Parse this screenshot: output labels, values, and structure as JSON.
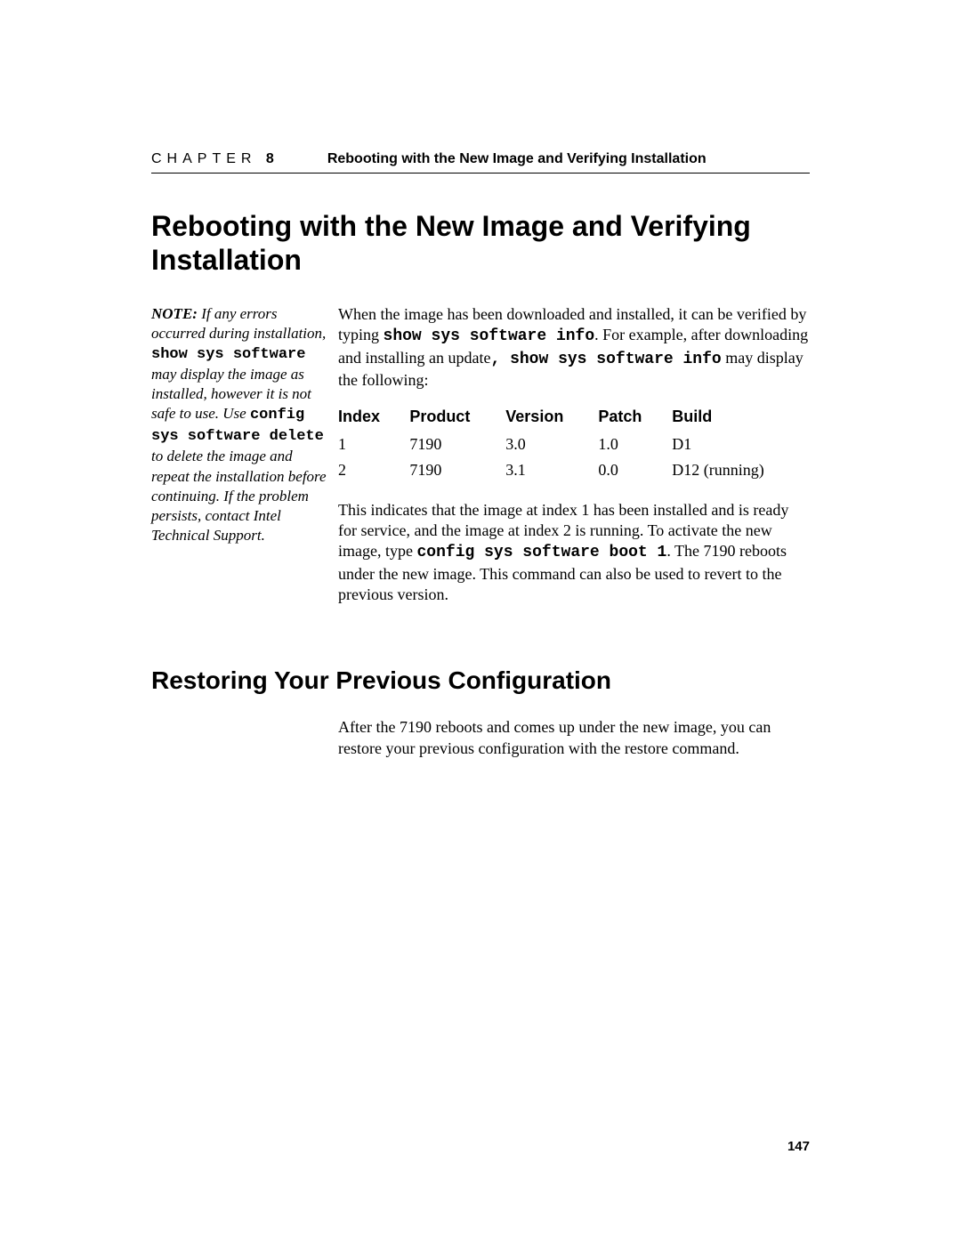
{
  "header": {
    "chapter_word": "CHAPTER",
    "chapter_num": "8",
    "title": "Rebooting with the New Image and Verifying Installation"
  },
  "section1": {
    "title": "Rebooting with the New Image and Verifying Installation",
    "note": {
      "lead": "NOTE:",
      "t1": "  If any errors occurred during installation, ",
      "c1": "show sys software",
      "t2": " may display the image as installed, however it is not safe to use. Use ",
      "c2": "config sys software delete",
      "t3": " to delete the image and repeat the installation before continuing. If the problem persists, contact Intel Technical Support."
    },
    "para1": {
      "t1": "When the image has been downloaded and installed, it can be verified by typing ",
      "c1": "show sys software info",
      "t2": ". For example, after downloading and installing an update",
      "c2": ", show sys software info",
      "t3": " may display the following:"
    },
    "table": {
      "headers": [
        "Index",
        "Product",
        "Version",
        "Patch",
        "Build"
      ],
      "rows": [
        [
          "1",
          "7190",
          "3.0",
          "1.0",
          "D1"
        ],
        [
          "2",
          "7190",
          "3.1",
          "0.0",
          "D12 (running)"
        ]
      ]
    },
    "para2": {
      "t1": "This indicates that the image at index 1 has been installed and is ready for service, and the image at index 2 is running. To activate the new image, type ",
      "c1": "config sys software boot 1",
      "t2": ". The 7190 reboots under the new image. This command can also be used to revert to the previous version."
    }
  },
  "section2": {
    "title": "Restoring Your Previous Configuration",
    "para": {
      "t1": "After the 7190 reboots and comes up under the new image, you can restore your previous configuration with the ",
      "c1": "restore",
      "t2": " command."
    }
  },
  "page_number": "147"
}
